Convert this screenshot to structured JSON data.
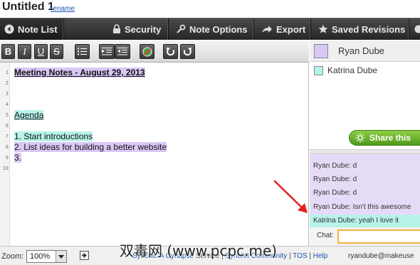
{
  "header": {
    "title": "Untitled 1",
    "rename_link": "rename"
  },
  "nav": {
    "items": [
      {
        "label": "Note List",
        "icon": "back-arrow-icon"
      },
      {
        "label": "Security",
        "icon": "lock-icon"
      },
      {
        "label": "Note Options",
        "icon": "wrench-icon"
      },
      {
        "label": "Export",
        "icon": "export-arrow-icon"
      },
      {
        "label": "Saved Revisions",
        "icon": "star-icon"
      }
    ]
  },
  "toolbar": {
    "bold": "B",
    "italic": "I",
    "underline": "U",
    "strike": "S",
    "bullet_list": "bullet-list-icon",
    "indent": "indent-icon",
    "outdent": "outdent-icon",
    "clear_authorship": "clear-authorship-icon",
    "undo": "undo-icon",
    "redo": "redo-icon"
  },
  "editor": {
    "line_numbers": [
      "1",
      "2",
      "3",
      "4",
      "5",
      "6",
      "7",
      "8",
      "9",
      "10"
    ],
    "lines": {
      "l1": "Meeting Notes - August 29, 2013",
      "l5": "Agenda",
      "l7": "1. Start introductions",
      "l8": "2. List ideas for building a better website",
      "l9": "3."
    }
  },
  "users": {
    "me": {
      "name": "Ryan Dube",
      "color": "#d9c8f5"
    },
    "others": [
      {
        "name": "Katrina Dube",
        "color": "#b7f3e9"
      }
    ],
    "share_label": "Share this"
  },
  "chat": {
    "messages": [
      {
        "text": "Ryan Dube: d"
      },
      {
        "text": "Ryan Dube: d"
      },
      {
        "text": "Ryan Dube: d"
      },
      {
        "text": "Ryan Dube: Isn't this awesome"
      },
      {
        "text": "Katrina Dube: yeah I love it"
      }
    ],
    "input_label": "Chat:",
    "input_value": ""
  },
  "footer": {
    "zoom_label": "Zoom:",
    "zoom_value": "100%",
    "synchit_service": "Synchit: A",
    "cynapse": "Cynapse",
    "service": "Service",
    "community": "SynchIt Community",
    "sep": "|",
    "tos": "TOS",
    "help": "Help",
    "email": "ryandube@makeuse"
  },
  "watermark": "双毒网 (www.pcpc.me)",
  "colors": {
    "nav_bg": "#2f2f2f",
    "author_ryan": "#d9c8f5",
    "author_katrina": "#b7f3e9",
    "share_green": "#6cb52c",
    "chat_input_border": "#f2b33d",
    "annotation_arrow": "#e02020"
  }
}
